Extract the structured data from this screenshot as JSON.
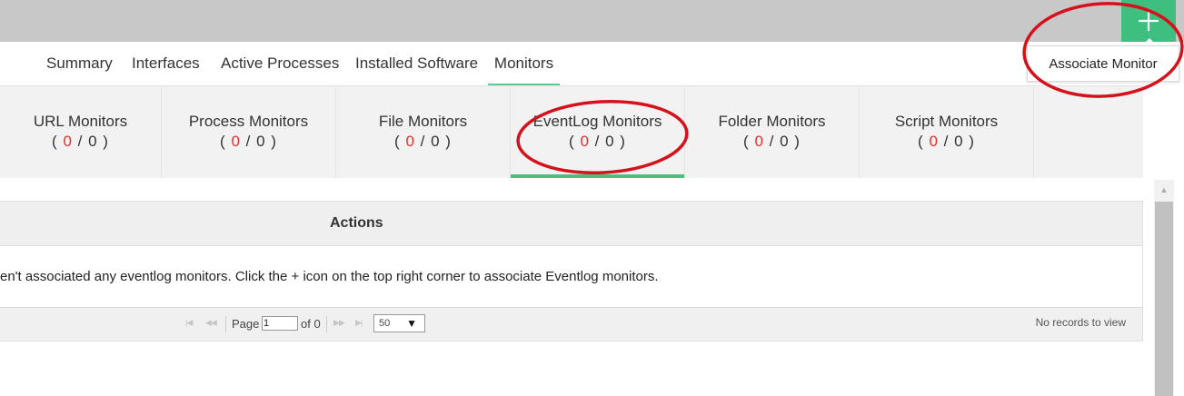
{
  "header": {
    "add_icon": "plus-icon",
    "accent": "#3fbf7f",
    "tooltip": "Associate Monitor"
  },
  "tabs": [
    {
      "label": "Summary"
    },
    {
      "label": "Interfaces"
    },
    {
      "label": "Active Processes"
    },
    {
      "label": "Installed Software"
    },
    {
      "label": "Monitors",
      "active": true
    }
  ],
  "subtabs": [
    {
      "name": "URL Monitors",
      "critical": "0",
      "total": "0"
    },
    {
      "name": "Process Monitors",
      "critical": "0",
      "total": "0"
    },
    {
      "name": "File Monitors",
      "critical": "0",
      "total": "0"
    },
    {
      "name": "EventLog Monitors",
      "critical": "0",
      "total": "0",
      "active": true
    },
    {
      "name": "Folder Monitors",
      "critical": "0",
      "total": "0"
    },
    {
      "name": "Script Monitors",
      "critical": "0",
      "total": "0"
    }
  ],
  "grid": {
    "actions_header": "Actions",
    "empty_message": "en't associated any eventlog monitors. Click the + icon on the top right corner to associate Eventlog monitors.",
    "pager": {
      "page_label": "Page",
      "page_value": "1",
      "of_label": "of 0",
      "page_size": "50",
      "status": "No records to view"
    }
  },
  "colors": {
    "critical_count": "#e0322b",
    "annotation": "#d5121c",
    "active_underline": "#4dbf7c"
  }
}
